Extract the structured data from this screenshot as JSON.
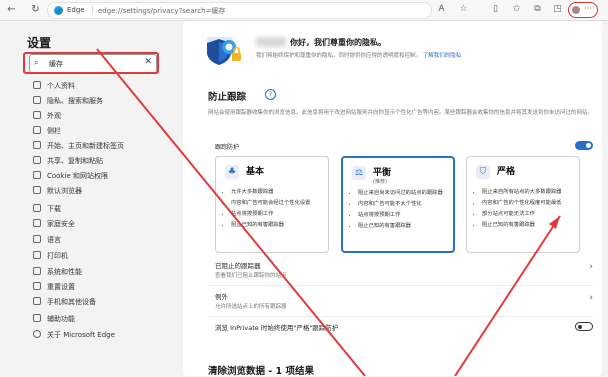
{
  "browser": {
    "brand": "Edge",
    "separator": "|",
    "url": "edge://settings/privacy?search=缓存"
  },
  "sidebar": {
    "title": "设置",
    "search": {
      "value": "缓存"
    },
    "items": [
      {
        "label": "个人资料"
      },
      {
        "label": "隐私、搜索和服务"
      },
      {
        "label": "外观"
      },
      {
        "label": "侧栏"
      },
      {
        "label": "开始、主页和新建标签页"
      },
      {
        "label": "共享、复制和粘贴"
      },
      {
        "label": "Cookie 和网站权限"
      },
      {
        "label": "默认浏览器"
      },
      {
        "label": "下载"
      },
      {
        "label": "家庭安全"
      },
      {
        "label": "语言"
      },
      {
        "label": "打印机"
      },
      {
        "label": "系统和性能"
      },
      {
        "label": "重置设置"
      },
      {
        "label": "手机和其他设备"
      },
      {
        "label": "辅助功能"
      },
      {
        "label": "关于 Microsoft Edge"
      }
    ]
  },
  "main": {
    "hero": {
      "title": "你好，我们尊重你的隐私。",
      "desc": "我们将始终保护和尊重你的隐私，同时提供你应得的透明度和控制。",
      "link": "了解我们的隐私"
    },
    "tracking": {
      "title": "防止跟踪",
      "desc": "网站会使用跟踪器收集你的浏览信息。此信息将用于改进网站服务并向你显示个性化广告等内容。某些跟踪器会收集你的信息并将其发送到你未访问过的网站。",
      "toggle_label": "跟踪防护",
      "toggle_on": true,
      "options": [
        {
          "title": "基本",
          "subtitle": "",
          "bullets": [
            "允许大多数跟踪器",
            "内容和广告可能会经过个性化设置",
            "站点将按预期工作",
            "阻止已知的有害跟踪器"
          ]
        },
        {
          "title": "平衡",
          "subtitle": "(推荐)",
          "bullets": [
            "阻止来自尚未访问过的站点的跟踪器",
            "内容和广告可能不太个性化",
            "站点将按预期工作",
            "阻止已知的有害跟踪器"
          ]
        },
        {
          "title": "严格",
          "subtitle": "",
          "bullets": [
            "阻止来自所有站点的大多数跟踪器",
            "内容和广告的个性化程度可能最低",
            "部分站点可能无法工作",
            "阻止已知的有害跟踪器"
          ]
        }
      ],
      "blocked": {
        "title": "已阻止的跟踪器",
        "desc": "查看我们已阻止跟踪你的站点"
      },
      "exceptions": {
        "title": "例外",
        "desc": "允许所选站点上的所有跟踪器"
      },
      "inprivate": {
        "label": "浏览 InPrivate 时始终使用\"严格\"跟踪防护",
        "on": false
      }
    },
    "clear": {
      "title": "清除浏览数据 - 1 项结果"
    }
  },
  "colors": {
    "accent": "#2a6fc9",
    "annotation": "#e03a3a"
  }
}
